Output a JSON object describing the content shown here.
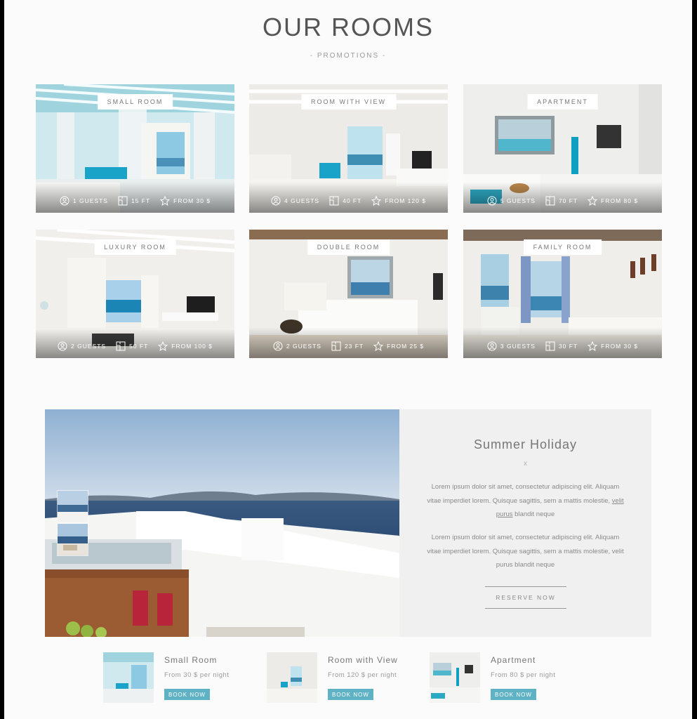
{
  "header": {
    "title": "OUR ROOMS",
    "subtitle": "- PROMOTIONS -"
  },
  "rooms": [
    {
      "name": "SMALL ROOM",
      "guests": "1 GUESTS",
      "size": "15 FT",
      "price": "FROM 30 $"
    },
    {
      "name": "ROOM WITH VIEW",
      "guests": "4 GUESTS",
      "size": "40 FT",
      "price": "FROM 120 $"
    },
    {
      "name": "APARTMENT",
      "guests": "5 GUESTS",
      "size": "70 FT",
      "price": "FROM 80 $"
    },
    {
      "name": "LUXURY ROOM",
      "guests": "2 GUESTS",
      "size": "50 FT",
      "price": "FROM 100 $"
    },
    {
      "name": "DOUBLE ROOM",
      "guests": "2 GUESTS",
      "size": "23 FT",
      "price": "FROM 25 $"
    },
    {
      "name": "FAMILY ROOM",
      "guests": "3 GUESTS",
      "size": "30 FT",
      "price": "FROM 30 $"
    }
  ],
  "promo": {
    "title": "Summer Holiday",
    "divider": "x",
    "para1_a": "Lorem ipsum dolor sit amet, consectetur adipiscing elit. Aliquam vitae imperdiet lorem. Quisque sagittis, sem a mattis molestie, ",
    "para1_link": "velit purus",
    "para1_b": " blandit neque",
    "para2": "Lorem ipsum dolor sit amet, consectetur adipiscing elit. Aliquam vitae imperdiet lorem. Quisque sagittis, sem a mattis molestie, velit purus blandit neque",
    "button": "RESERVE NOW"
  },
  "featured": [
    {
      "name": "Small Room",
      "price": "From 30 $ per night",
      "button": "BOOK NOW"
    },
    {
      "name": "Room with View",
      "price": "From 120 $ per night",
      "button": "BOOK NOW"
    },
    {
      "name": "Apartment",
      "price": "From 80 $ per night",
      "button": "BOOK NOW"
    }
  ],
  "colors": {
    "accent": "#5fb1c4",
    "text": "#777777",
    "panel": "#f0f0f0"
  },
  "icons": {
    "guests": "user-circle-icon",
    "size": "floorplan-icon",
    "price": "star-icon"
  }
}
